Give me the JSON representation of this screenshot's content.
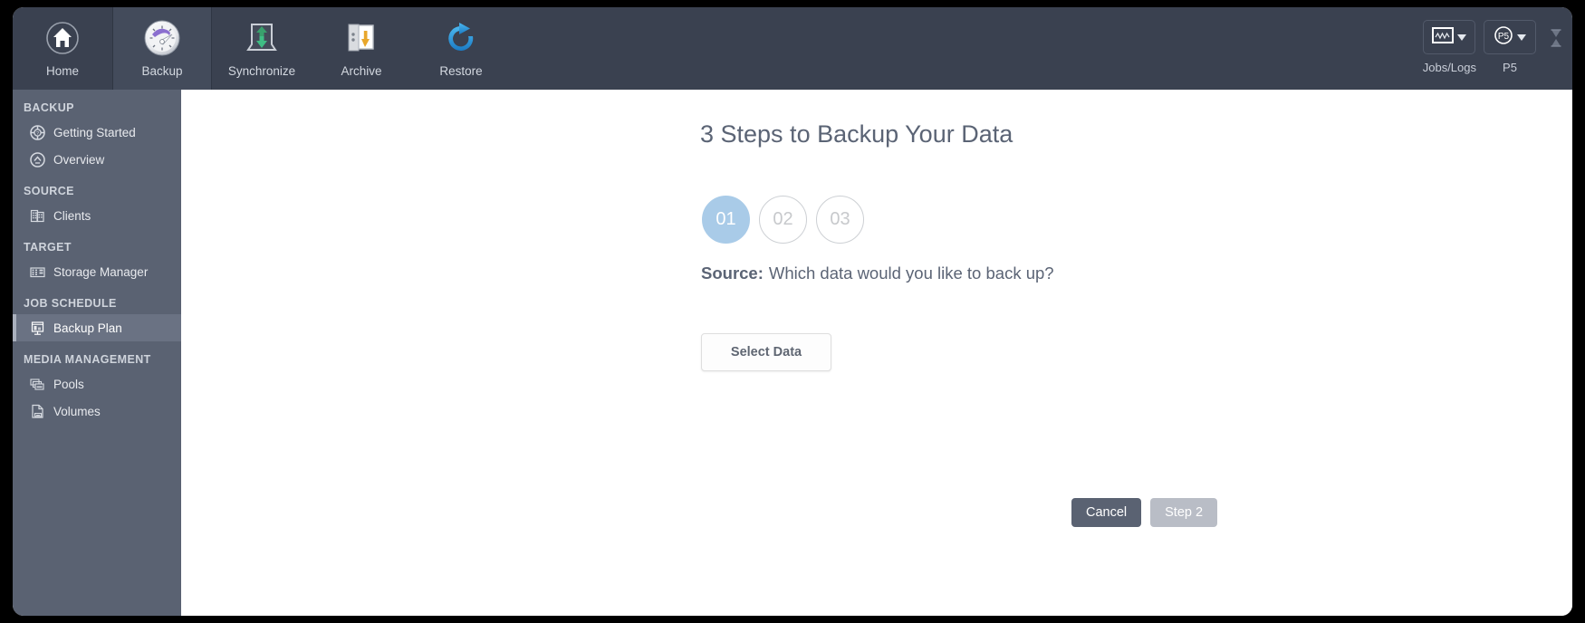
{
  "toolbar": {
    "items": [
      {
        "label": "Home",
        "icon": "home-icon",
        "active": false
      },
      {
        "label": "Backup",
        "icon": "backup-gauge-icon",
        "active": true
      },
      {
        "label": "Synchronize",
        "icon": "synchronize-icon",
        "active": false
      },
      {
        "label": "Archive",
        "icon": "archive-icon",
        "active": false
      },
      {
        "label": "Restore",
        "icon": "restore-refresh-icon",
        "active": false
      }
    ],
    "right_buttons": [
      {
        "label": "Jobs/Logs",
        "icon": "waveform-icon"
      },
      {
        "label": "P5",
        "icon": "p5-badge-icon"
      }
    ],
    "status_icon": "hourglass-icon"
  },
  "sidebar": {
    "groups": [
      {
        "title": "BACKUP",
        "items": [
          {
            "label": "Getting Started",
            "icon": "lifebuoy-icon",
            "selected": false
          },
          {
            "label": "Overview",
            "icon": "overview-chevron-icon",
            "selected": false
          }
        ]
      },
      {
        "title": "SOURCE",
        "items": [
          {
            "label": "Clients",
            "icon": "clients-building-icon",
            "selected": false
          }
        ]
      },
      {
        "title": "TARGET",
        "items": [
          {
            "label": "Storage Manager",
            "icon": "storage-manager-icon",
            "selected": false
          }
        ]
      },
      {
        "title": "JOB SCHEDULE",
        "items": [
          {
            "label": "Backup Plan",
            "icon": "backup-plan-icon",
            "selected": true
          }
        ]
      },
      {
        "title": "MEDIA MANAGEMENT",
        "items": [
          {
            "label": "Pools",
            "icon": "pools-icon",
            "selected": false
          },
          {
            "label": "Volumes",
            "icon": "volumes-icon",
            "selected": false
          }
        ]
      }
    ]
  },
  "main": {
    "title": "3 Steps to Backup Your Data",
    "steps": [
      {
        "number": "01",
        "state": "active"
      },
      {
        "number": "02",
        "state": "inactive"
      },
      {
        "number": "03",
        "state": "inactive"
      }
    ],
    "source_label": "Source:",
    "source_question": "Which data would you like to back up?",
    "select_data_label": "Select Data",
    "cancel_label": "Cancel",
    "next_step_label": "Step 2"
  },
  "colors": {
    "toolbar_bg": "#3a4150",
    "toolbar_active_bg": "#434b5b",
    "sidebar_bg": "#5a6272",
    "sidebar_selected_bg": "#6a7283",
    "step_active_fill": "#a9cbe8",
    "heading_text": "#5b6475",
    "cancel_bg": "#5a6272",
    "step2_bg": "#b9bdc6"
  }
}
